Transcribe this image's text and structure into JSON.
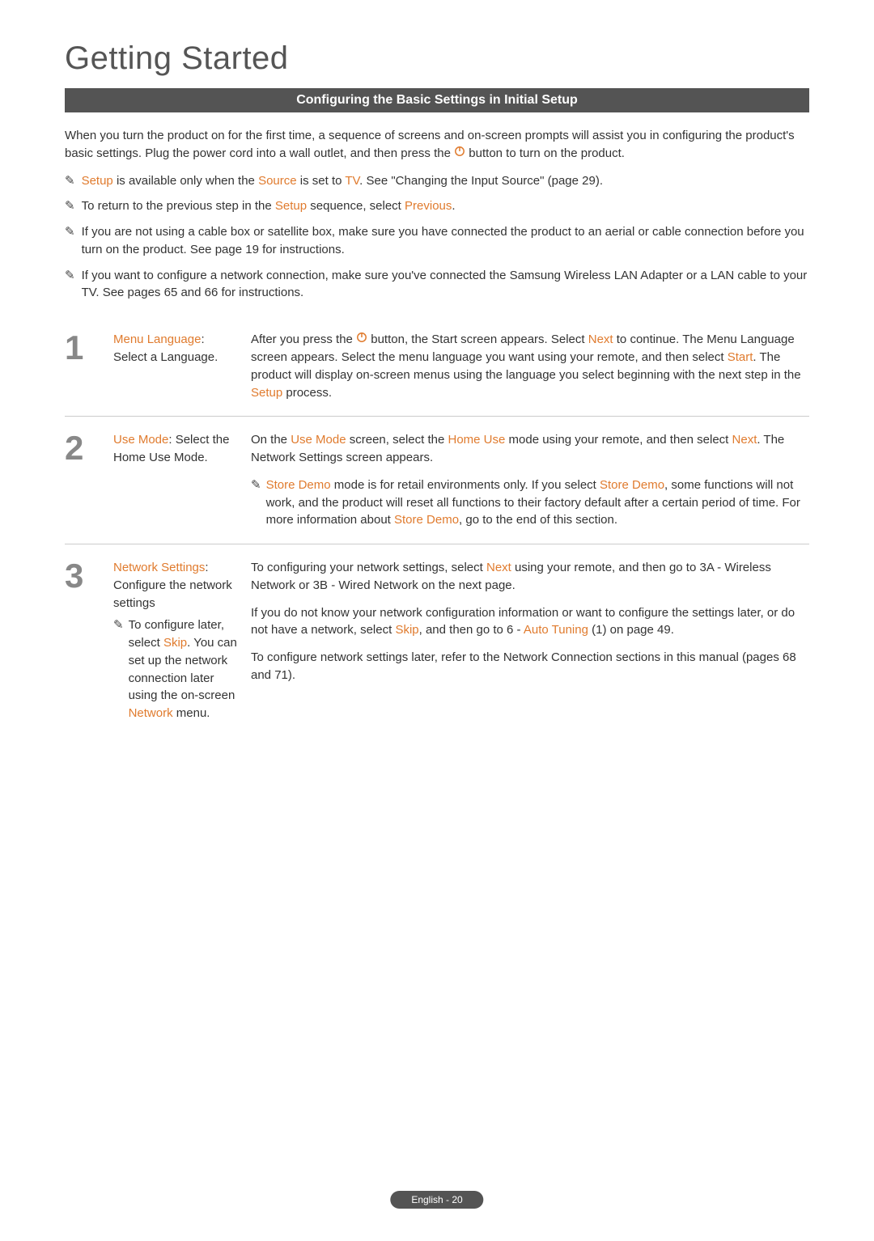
{
  "page_title": "Getting Started",
  "section_heading": "Configuring the Basic Settings in Initial Setup",
  "intro": {
    "p1a": "When you turn the product on for the first time, a sequence of screens and on-screen prompts will assist you in configuring the product's basic settings. Plug the power cord into a wall outlet, and then press the ",
    "p1b": " button to turn on the product."
  },
  "notes": [
    {
      "a": "",
      "hl1": "Setup",
      "b": " is available only when the ",
      "hl2": "Source",
      "c": " is set to ",
      "hl3": "TV",
      "d": ". See \"Changing the Input Source\" (page 29)."
    },
    {
      "a": "To return to the previous step in the ",
      "hl1": "Setup",
      "b": " sequence, select ",
      "hl2": "Previous",
      "c": ".",
      "hl3": "",
      "d": ""
    },
    {
      "a": "If you are not using a cable box or satellite box, make sure you have connected the product to an aerial or cable connection before you turn on the product. See page 19 for instructions.",
      "hl1": "",
      "b": "",
      "hl2": "",
      "c": "",
      "hl3": "",
      "d": ""
    },
    {
      "a": "If you want to configure a network connection, make sure you've connected the Samsung Wireless LAN Adapter or a LAN cable to your TV. See pages 65 and 66 for instructions.",
      "hl1": "",
      "b": "",
      "hl2": "",
      "c": "",
      "hl3": "",
      "d": ""
    }
  ],
  "steps": [
    {
      "num": "1",
      "left_title": "Menu Language",
      "left_rest": ": Select a Language.",
      "right": {
        "p1_a": "After you press the ",
        "p1_b": " button, the Start screen appears. Select ",
        "p1_hl1": "Next",
        "p1_c": " to continue. The Menu Language screen appears. Select the menu language you want using your remote, and then select ",
        "p1_hl2": "Start",
        "p1_d": ". The product will display on-screen menus using the language you select beginning with the next step in the ",
        "p1_hl3": "Setup",
        "p1_e": " process."
      }
    },
    {
      "num": "2",
      "left_title": "Use Mode",
      "left_rest": ": Select the Home Use Mode.",
      "right": {
        "p1_a": "On the ",
        "p1_hl1": "Use Mode",
        "p1_b": " screen, select the ",
        "p1_hl2": "Home Use",
        "p1_c": " mode using your remote, and then select ",
        "p1_hl3": "Next",
        "p1_d": ". The Network Settings screen appears.",
        "note_hl1": "Store Demo",
        "note_a": " mode is for retail environments only. If you select ",
        "note_hl2": "Store Demo",
        "note_b": ", some functions will not work, and the product will reset all functions to their factory default after a certain period of time. For more information about ",
        "note_hl3": "Store Demo",
        "note_c": ", go to the end of this section."
      }
    },
    {
      "num": "3",
      "left_title": "Network Settings",
      "left_rest": ": Configure the network settings",
      "left_note_a": "To configure later, select ",
      "left_note_hl1": "Skip",
      "left_note_b": ". You can set up the network connection later using the on-screen ",
      "left_note_hl2": "Network",
      "left_note_c": " menu.",
      "right": {
        "p1_a": "To configuring your network settings, select ",
        "p1_hl1": "Next",
        "p1_b": " using your remote, and then go to 3A - Wireless Network or 3B - Wired Network on the next page.",
        "p2_a": "If you do not know your network configuration information or want to configure the settings later, or do not have a network, select ",
        "p2_hl1": "Skip",
        "p2_b": ", and then go to 6 - ",
        "p2_hl2": "Auto Tuning",
        "p2_c": " (1) on page 49.",
        "p3": "To configure network settings later, refer to the Network Connection sections in this manual (pages 68 and 71)."
      }
    }
  ],
  "footer": "English - 20"
}
